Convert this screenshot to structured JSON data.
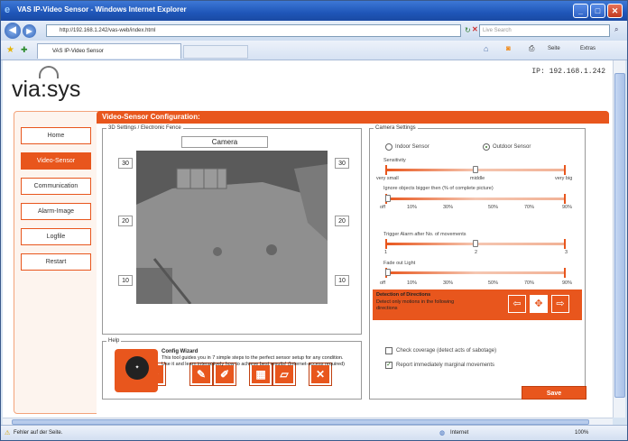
{
  "browser": {
    "title": "VAS IP-Video Sensor - Windows Internet Explorer",
    "url": "http://192.168.1.242/vas-web/index.html",
    "search_placeholder": "Live Search",
    "tab_label": "VAS IP-Video Sensor",
    "toolbar": {
      "page_label": "Seite",
      "extras_label": "Extras"
    },
    "status_text": "Fehler auf der Seite.",
    "zone": "Internet",
    "zoom": "100%"
  },
  "header": {
    "logo": "via:sys",
    "ip": "IP: 192.168.1.242"
  },
  "nav": {
    "items": [
      "Home",
      "Video-Sensor",
      "Communication",
      "Alarm-Image",
      "Logfile",
      "Restart"
    ],
    "active": "Video-Sensor"
  },
  "config": {
    "title": "Video-Sensor Configuration:"
  },
  "fence": {
    "legend": "3D Settings / Electronic Fence",
    "camera_label": "Camera",
    "left_values": [
      "30",
      "20",
      "10"
    ],
    "right_values": [
      "30",
      "20",
      "10"
    ]
  },
  "camera_settings": {
    "legend": "Camera Settings",
    "indoor_label": "Indoor Sensor",
    "outdoor_label": "Outdoor Sensor",
    "sensor_type": "outdoor",
    "sensitivity": {
      "label": "Sensitivity",
      "ticks": [
        "very small",
        "middle",
        "very big"
      ],
      "value_fraction": 0.5
    },
    "ignore": {
      "label": "Ignore objects bigger then (% of complete picture)",
      "ticks": [
        "off",
        "10%",
        "30%",
        "50%",
        "70%",
        "90%"
      ],
      "value_fraction": 0.0
    },
    "trigger": {
      "label": "Trigger Alarm after No. of movements",
      "ticks": [
        "1",
        "2",
        "3"
      ],
      "value_fraction": 0.5
    },
    "fade": {
      "label": "Fade out Light",
      "ticks": [
        "off",
        "10%",
        "30%",
        "50%",
        "70%",
        "90%"
      ],
      "value_fraction": 0.0
    },
    "directions": {
      "title": "Detection of Directions",
      "desc": "Detect only motions in the following directions"
    },
    "check_coverage": "Check coverage (detect acts of sabotage)",
    "report_marginal": "Report immediately marginal movements",
    "check_coverage_checked": false,
    "report_marginal_checked": true,
    "save_label": "Save"
  },
  "help": {
    "legend": "Help",
    "wizard_title": "Config Wizard",
    "wizard_text": "This tool guides you in 7 simple steps to the perfect sensor setup for any condition. Use it and learn interactively how to achieve best results! (Internet-access required)"
  }
}
